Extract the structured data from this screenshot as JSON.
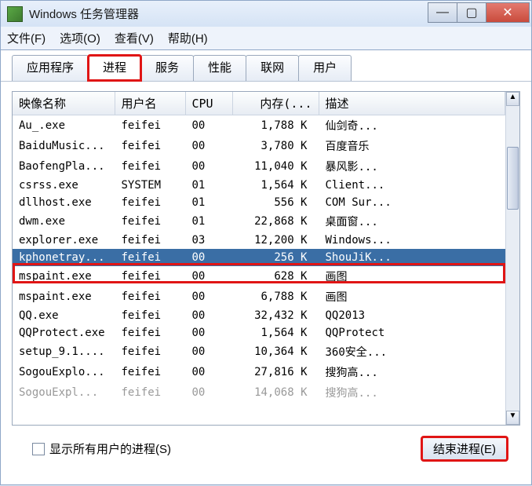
{
  "window": {
    "title": "Windows 任务管理器"
  },
  "window_buttons": {
    "minimize": "—",
    "maximize": "▢",
    "close": "✕"
  },
  "menu": {
    "file": "文件(F)",
    "options": "选项(O)",
    "view": "查看(V)",
    "help": "帮助(H)"
  },
  "tabs": {
    "applications": "应用程序",
    "processes": "进程",
    "services": "服务",
    "performance": "性能",
    "networking": "联网",
    "users": "用户"
  },
  "columns": {
    "image_name": "映像名称",
    "user_name": "用户名",
    "cpu": "CPU",
    "memory": "内存(...",
    "description": "描述"
  },
  "rows": [
    {
      "name": "Au_.exe",
      "user": "feifei",
      "cpu": "00",
      "mem": "1,788 K",
      "desc": "仙剑奇..."
    },
    {
      "name": "BaiduMusic...",
      "user": "feifei",
      "cpu": "00",
      "mem": "3,780 K",
      "desc": "百度音乐"
    },
    {
      "name": "BaofengPla...",
      "user": "feifei",
      "cpu": "00",
      "mem": "11,040 K",
      "desc": "暴风影..."
    },
    {
      "name": "csrss.exe",
      "user": "SYSTEM",
      "cpu": "01",
      "mem": "1,564 K",
      "desc": "Client..."
    },
    {
      "name": "dllhost.exe",
      "user": "feifei",
      "cpu": "01",
      "mem": "556 K",
      "desc": "COM Sur..."
    },
    {
      "name": "dwm.exe",
      "user": "feifei",
      "cpu": "01",
      "mem": "22,868 K",
      "desc": "桌面窗..."
    },
    {
      "name": "explorer.exe",
      "user": "feifei",
      "cpu": "03",
      "mem": "12,200 K",
      "desc": "Windows..."
    },
    {
      "name": "kphonetray...",
      "user": "feifei",
      "cpu": "00",
      "mem": "256 K",
      "desc": "ShouJiK...",
      "selected": true
    },
    {
      "name": "mspaint.exe",
      "user": "feifei",
      "cpu": "00",
      "mem": "628 K",
      "desc": "画图"
    },
    {
      "name": "mspaint.exe",
      "user": "feifei",
      "cpu": "00",
      "mem": "6,788 K",
      "desc": "画图"
    },
    {
      "name": "QQ.exe",
      "user": "feifei",
      "cpu": "00",
      "mem": "32,432 K",
      "desc": "QQ2013"
    },
    {
      "name": "QQProtect.exe",
      "user": "feifei",
      "cpu": "00",
      "mem": "1,564 K",
      "desc": "QQProtect"
    },
    {
      "name": "setup_9.1....",
      "user": "feifei",
      "cpu": "00",
      "mem": "10,364 K",
      "desc": "360安全..."
    },
    {
      "name": "SogouExplo...",
      "user": "feifei",
      "cpu": "00",
      "mem": "27,816 K",
      "desc": "搜狗高..."
    },
    {
      "name": "SogouExpl...",
      "user": "feifei",
      "cpu": "00",
      "mem": "14,068 K",
      "desc": "搜狗高...",
      "partial": true
    }
  ],
  "footer": {
    "show_all_users": "显示所有用户的进程(S)",
    "end_process": "结束进程(E)"
  }
}
